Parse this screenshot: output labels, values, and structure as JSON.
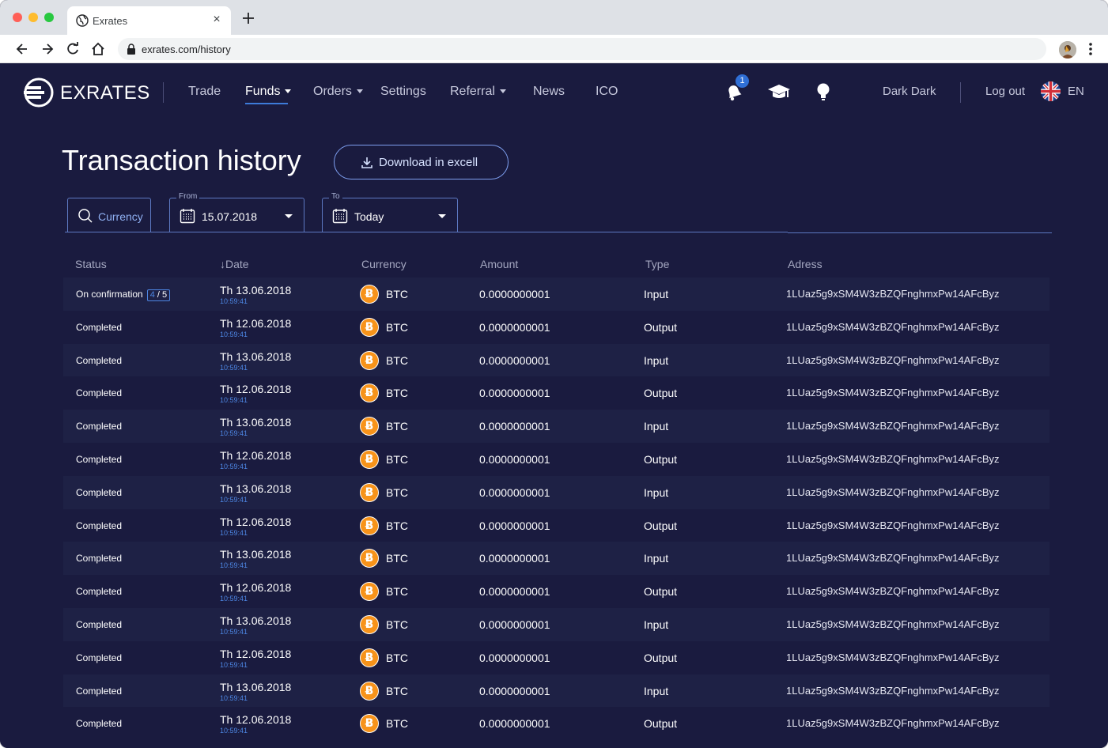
{
  "browser": {
    "tab_title": "Exrates",
    "url": "exrates.com/history"
  },
  "app": {
    "logo_text": "EXRATES",
    "nav": {
      "trade": "Trade",
      "funds": "Funds",
      "orders": "Orders",
      "settings": "Settings",
      "referral": "Referral",
      "news": "News",
      "ico": "ICO"
    },
    "notifications_count": "1",
    "user_name": "Dark Dark",
    "logout": "Log out",
    "language": "EN"
  },
  "page": {
    "title": "Transaction history",
    "download_label": "Download in excell"
  },
  "filters": {
    "currency_placeholder": "Currency",
    "from_caption": "From",
    "from_value": "15.07.2018",
    "to_caption": "To",
    "to_value": "Today"
  },
  "table": {
    "headers": {
      "status": "Status",
      "date": "Date",
      "currency": "Currency",
      "amount": "Amount",
      "type": "Type",
      "address": "Adress"
    },
    "rows": [
      {
        "status": "On confirmation",
        "confirm_done": "4",
        "confirm_total": "/ 5",
        "date": "Th 13.06.2018",
        "time": "10:59:41",
        "currency": "BTC",
        "amount": "0.0000000001",
        "type": "Input",
        "address": "1LUaz5g9xSM4W3zBZQFnghmxPw14AFcByz"
      },
      {
        "status": "Completed",
        "date": "Th 12.06.2018",
        "time": "10:59:41",
        "currency": "BTC",
        "amount": "0.0000000001",
        "type": "Output",
        "address": "1LUaz5g9xSM4W3zBZQFnghmxPw14AFcByz"
      },
      {
        "status": "Completed",
        "date": "Th 13.06.2018",
        "time": "10:59:41",
        "currency": "BTC",
        "amount": "0.0000000001",
        "type": "Input",
        "address": "1LUaz5g9xSM4W3zBZQFnghmxPw14AFcByz"
      },
      {
        "status": "Completed",
        "date": "Th 12.06.2018",
        "time": "10:59:41",
        "currency": "BTC",
        "amount": "0.0000000001",
        "type": "Output",
        "address": "1LUaz5g9xSM4W3zBZQFnghmxPw14AFcByz"
      },
      {
        "status": "Completed",
        "date": "Th 13.06.2018",
        "time": "10:59:41",
        "currency": "BTC",
        "amount": "0.0000000001",
        "type": "Input",
        "address": "1LUaz5g9xSM4W3zBZQFnghmxPw14AFcByz"
      },
      {
        "status": "Completed",
        "date": "Th 12.06.2018",
        "time": "10:59:41",
        "currency": "BTC",
        "amount": "0.0000000001",
        "type": "Output",
        "address": "1LUaz5g9xSM4W3zBZQFnghmxPw14AFcByz"
      },
      {
        "status": "Completed",
        "date": "Th 13.06.2018",
        "time": "10:59:41",
        "currency": "BTC",
        "amount": "0.0000000001",
        "type": "Input",
        "address": "1LUaz5g9xSM4W3zBZQFnghmxPw14AFcByz"
      },
      {
        "status": "Completed",
        "date": "Th 12.06.2018",
        "time": "10:59:41",
        "currency": "BTC",
        "amount": "0.0000000001",
        "type": "Output",
        "address": "1LUaz5g9xSM4W3zBZQFnghmxPw14AFcByz"
      },
      {
        "status": "Completed",
        "date": "Th 13.06.2018",
        "time": "10:59:41",
        "currency": "BTC",
        "amount": "0.0000000001",
        "type": "Input",
        "address": "1LUaz5g9xSM4W3zBZQFnghmxPw14AFcByz"
      },
      {
        "status": "Completed",
        "date": "Th 12.06.2018",
        "time": "10:59:41",
        "currency": "BTC",
        "amount": "0.0000000001",
        "type": "Output",
        "address": "1LUaz5g9xSM4W3zBZQFnghmxPw14AFcByz"
      },
      {
        "status": "Completed",
        "date": "Th 13.06.2018",
        "time": "10:59:41",
        "currency": "BTC",
        "amount": "0.0000000001",
        "type": "Input",
        "address": "1LUaz5g9xSM4W3zBZQFnghmxPw14AFcByz"
      },
      {
        "status": "Completed",
        "date": "Th 12.06.2018",
        "time": "10:59:41",
        "currency": "BTC",
        "amount": "0.0000000001",
        "type": "Output",
        "address": "1LUaz5g9xSM4W3zBZQFnghmxPw14AFcByz"
      },
      {
        "status": "Completed",
        "date": "Th 13.06.2018",
        "time": "10:59:41",
        "currency": "BTC",
        "amount": "0.0000000001",
        "type": "Input",
        "address": "1LUaz5g9xSM4W3zBZQFnghmxPw14AFcByz"
      },
      {
        "status": "Completed",
        "date": "Th 12.06.2018",
        "time": "10:59:41",
        "currency": "BTC",
        "amount": "0.0000000001",
        "type": "Output",
        "address": "1LUaz5g9xSM4W3zBZQFnghmxPw14AFcByz"
      }
    ]
  },
  "icons": [
    "globe-icon",
    "close-icon",
    "plus-icon",
    "back-arrow-icon",
    "forward-arrow-icon",
    "reload-icon",
    "home-icon",
    "lock-icon",
    "kebab-menu-icon",
    "bell-icon",
    "graduation-cap-icon",
    "lightbulb-icon",
    "uk-flag-icon",
    "download-icon",
    "search-icon",
    "calendar-icon",
    "bitcoin-icon"
  ],
  "colors": {
    "background": "#1a1b3f",
    "accent": "#3d7bd9",
    "bitcoin": "#f7931a"
  }
}
